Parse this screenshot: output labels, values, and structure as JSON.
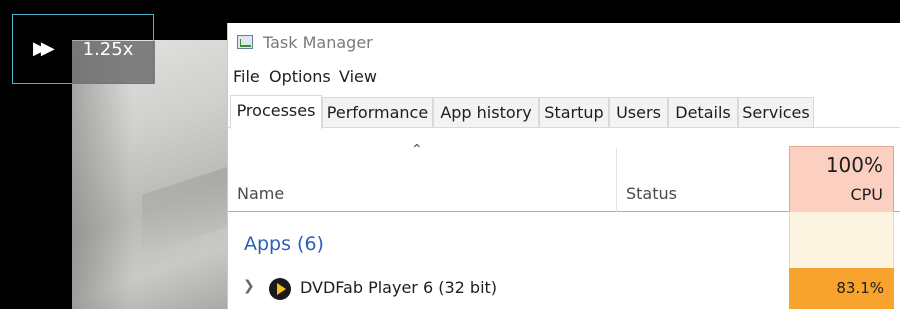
{
  "player": {
    "speed_label": "1.25x",
    "fast_forward_glyph": "▶▶"
  },
  "window": {
    "title": "Task Manager"
  },
  "menu": [
    "File",
    "Options",
    "View"
  ],
  "tabs": [
    "Processes",
    "Performance",
    "App history",
    "Startup",
    "Users",
    "Details",
    "Services"
  ],
  "active_tab": "Processes",
  "columns": {
    "name": "Name",
    "status": "Status",
    "cpu_percent": "100%",
    "cpu": "CPU"
  },
  "group": {
    "title": "Apps (6)"
  },
  "rows": [
    {
      "name": "DVDFab Player 6 (32 bit)",
      "status": "",
      "cpu": "83.1%"
    }
  ],
  "colors": {
    "cpu_header": "#fcd0c0",
    "cpu_high": "#f7a32e",
    "cpu_low": "#fdf3e1",
    "group_title": "#2d5fb8",
    "overlay_border": "#4fb3c8"
  },
  "icons": {
    "title": "task-manager-icon",
    "row": "dvdfab-play-icon"
  }
}
